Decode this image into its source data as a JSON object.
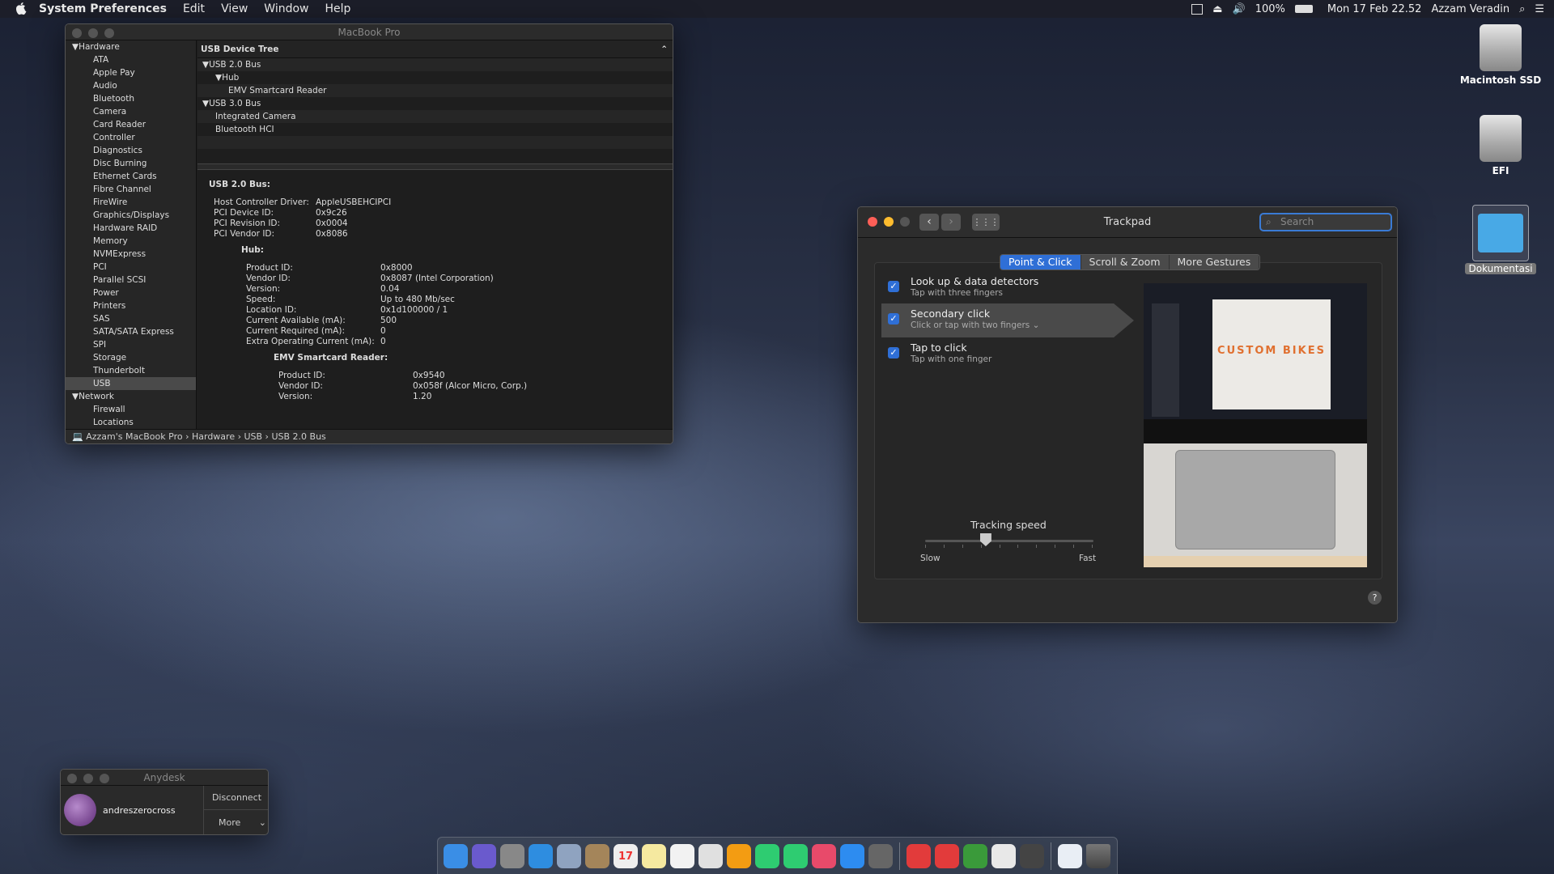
{
  "menubar": {
    "app": "System Preferences",
    "items": [
      "Edit",
      "View",
      "Window",
      "Help"
    ],
    "battery": "100%",
    "clock": "Mon 17 Feb  22.52",
    "user": "Azzam Veradin"
  },
  "sysinfo": {
    "title": "MacBook Pro",
    "sidebar": {
      "hardware": "Hardware",
      "items": [
        "ATA",
        "Apple Pay",
        "Audio",
        "Bluetooth",
        "Camera",
        "Card Reader",
        "Controller",
        "Diagnostics",
        "Disc Burning",
        "Ethernet Cards",
        "Fibre Channel",
        "FireWire",
        "Graphics/Displays",
        "Hardware RAID",
        "Memory",
        "NVMExpress",
        "PCI",
        "Parallel SCSI",
        "Power",
        "Printers",
        "SAS",
        "SATA/SATA Express",
        "SPI",
        "Storage",
        "Thunderbolt",
        "USB"
      ],
      "network": "Network",
      "network_items": [
        "Firewall",
        "Locations"
      ]
    },
    "tree_header": "USB Device Tree",
    "tree": [
      {
        "label": "▼USB 2.0 Bus",
        "indent": 0
      },
      {
        "label": "▼Hub",
        "indent": 1
      },
      {
        "label": "EMV Smartcard Reader",
        "indent": 2
      },
      {
        "label": "▼USB 3.0 Bus",
        "indent": 0
      },
      {
        "label": "Integrated Camera",
        "indent": 1
      },
      {
        "label": "Bluetooth HCI",
        "indent": 1
      }
    ],
    "detail_title": "USB 2.0 Bus:",
    "bus_rows": [
      [
        "Host Controller Driver:",
        "AppleUSBEHCIPCI"
      ],
      [
        "PCI Device ID:",
        "0x9c26"
      ],
      [
        "PCI Revision ID:",
        "0x0004"
      ],
      [
        "PCI Vendor ID:",
        "0x8086"
      ]
    ],
    "hub_title": "Hub:",
    "hub_rows": [
      [
        "Product ID:",
        "0x8000"
      ],
      [
        "Vendor ID:",
        "0x8087  (Intel Corporation)"
      ],
      [
        "Version:",
        "0.04"
      ],
      [
        "Speed:",
        "Up to 480 Mb/sec"
      ],
      [
        "Location ID:",
        "0x1d100000 / 1"
      ],
      [
        "Current Available (mA):",
        "500"
      ],
      [
        "Current Required (mA):",
        "0"
      ],
      [
        "Extra Operating Current (mA):",
        "0"
      ]
    ],
    "emv_title": "EMV Smartcard Reader:",
    "emv_rows": [
      [
        "Product ID:",
        "0x9540"
      ],
      [
        "Vendor ID:",
        "0x058f  (Alcor Micro, Corp.)"
      ],
      [
        "Version:",
        "1.20"
      ]
    ],
    "path": "Azzam's MacBook Pro  ›  Hardware  ›  USB  ›  USB 2.0 Bus"
  },
  "trackpad": {
    "title": "Trackpad",
    "search_placeholder": "Search",
    "tabs": [
      "Point & Click",
      "Scroll & Zoom",
      "More Gestures"
    ],
    "options": [
      {
        "label": "Look up & data detectors",
        "sub": "Tap with three fingers"
      },
      {
        "label": "Secondary click",
        "sub": "Click or tap with two fingers ⌄"
      },
      {
        "label": "Tap to click",
        "sub": "Tap with one finger"
      }
    ],
    "tracking": {
      "label": "Tracking speed",
      "slow": "Slow",
      "fast": "Fast",
      "value": 0.35
    },
    "preview_text": "CUSTOM BIKES",
    "help": "?"
  },
  "anydesk": {
    "title": "Anydesk",
    "user": "andreszerocross",
    "disconnect": "Disconnect",
    "more": "More"
  },
  "desktop": {
    "disks": [
      "Macintosh SSD",
      "EFI",
      "Dokumentasi"
    ]
  },
  "dock": {
    "date_icon": "17"
  }
}
